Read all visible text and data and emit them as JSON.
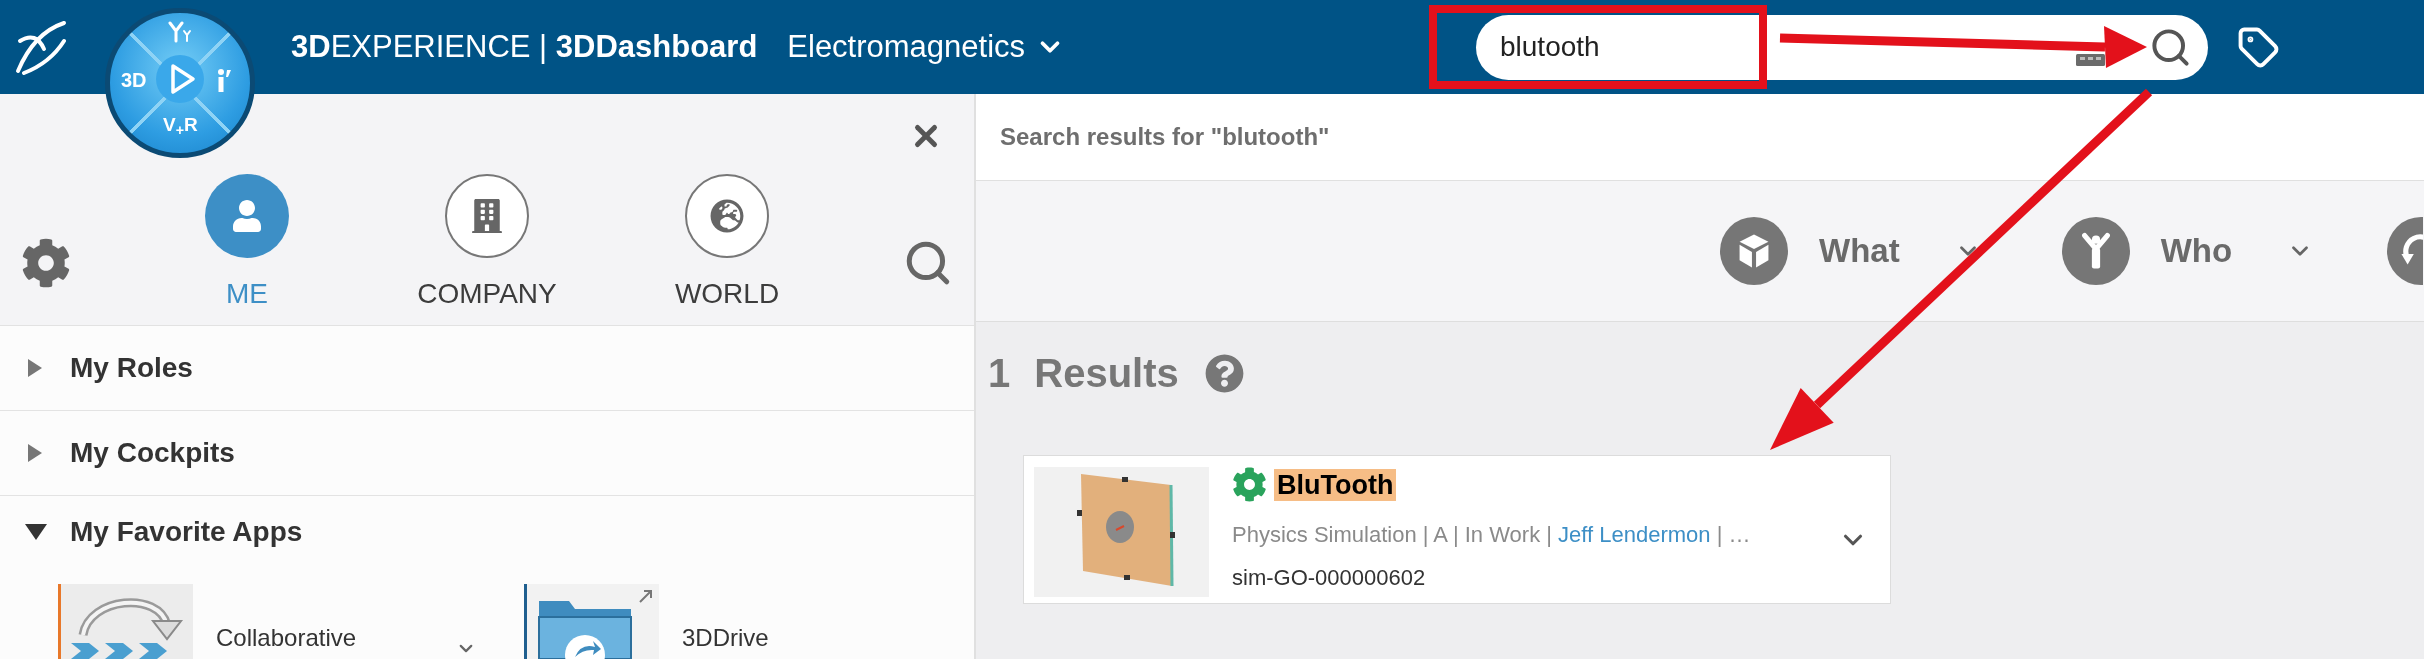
{
  "header": {
    "app_title": "**3D**EXPERIENCE | **3DDashboard**",
    "workspace": "Electromagnetics",
    "compass": {
      "west_label": "3D",
      "south_label": "V$_{+}$R"
    },
    "search": {
      "value": "blutooth"
    }
  },
  "sidebar": {
    "tabs": [
      {
        "label": "ME",
        "kind": "me",
        "selected": true
      },
      {
        "label": "COMPANY",
        "kind": "company",
        "selected": false
      },
      {
        "label": "WORLD",
        "kind": "world",
        "selected": false
      }
    ],
    "sections": [
      {
        "label": "My Roles",
        "expanded": false
      },
      {
        "label": "My Cockpits",
        "expanded": false
      },
      {
        "label": "My Favorite Apps",
        "expanded": true,
        "apps": [
          {
            "name": "Collaborative",
            "kind": "collaborative",
            "color": "#e8782a",
            "menu": true
          },
          {
            "name": "3DDrive",
            "kind": "drive",
            "color": "#1f5f8f",
            "menu": false
          }
        ]
      }
    ]
  },
  "results": {
    "title": "Search results for \"blutooth\"",
    "filters": [
      {
        "label": "What",
        "kind": "what"
      },
      {
        "label": "Who",
        "kind": "who"
      },
      {
        "kind": "clipped"
      }
    ],
    "count": "1",
    "count_label": "Results",
    "items": [
      {
        "title": "BluTooth",
        "highlighted": true,
        "meta": [
          {
            "text": "Physics Simulation | A | In Work | ",
            "kind": "plain"
          },
          {
            "text": "Jeff Lendermon",
            "kind": "link"
          },
          {
            "text": " | …",
            "kind": "plain"
          }
        ],
        "id": "sim-GO-000000602"
      }
    ]
  }
}
